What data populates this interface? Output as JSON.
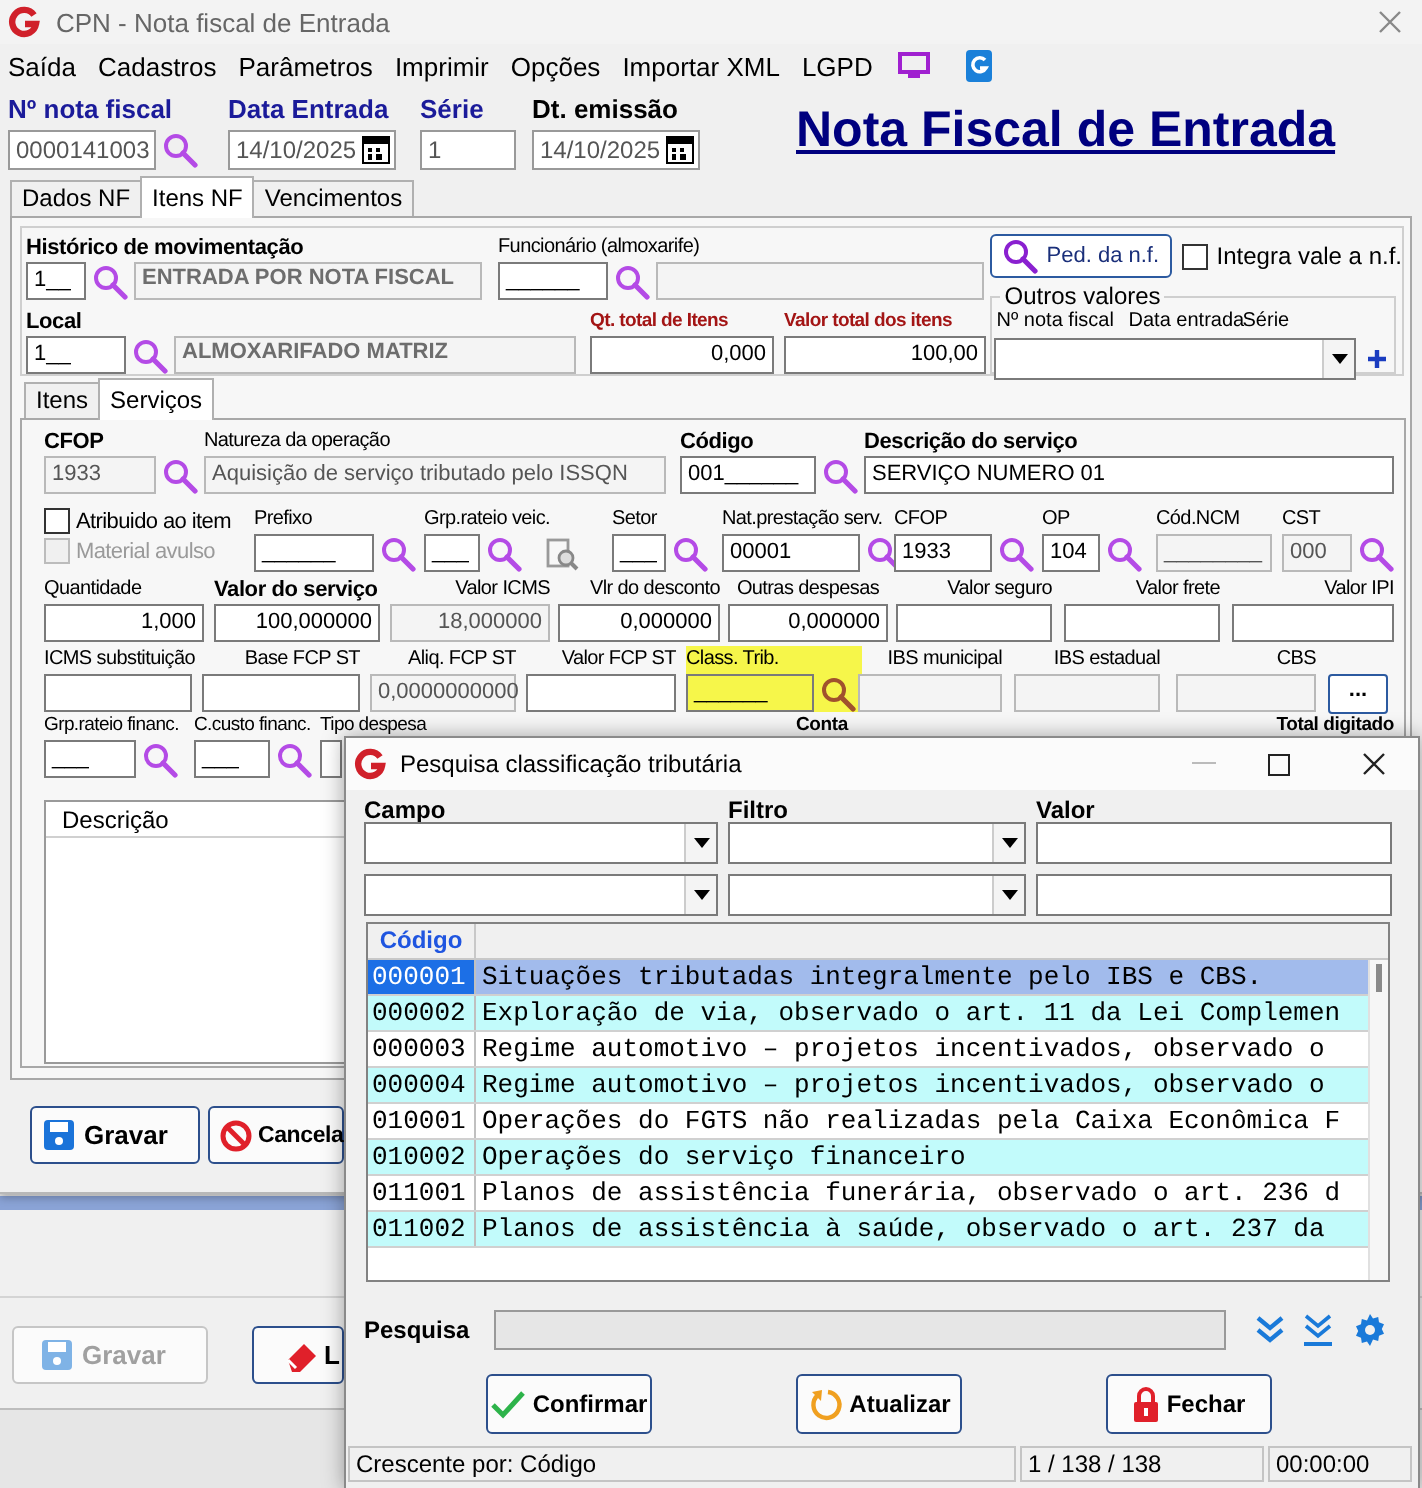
{
  "window": {
    "title": "CPN - Nota fiscal de Entrada"
  },
  "menu": [
    "Saída",
    "Cadastros",
    "Parâmetros",
    "Imprimir",
    "Opções",
    "Importar XML",
    "LGPD"
  ],
  "header": {
    "fields": [
      {
        "label": "Nº nota fiscal",
        "value": "0000141003",
        "kind": "lookup"
      },
      {
        "label": "Data Entrada",
        "value": "14/10/2025",
        "kind": "date"
      },
      {
        "label": "Série",
        "value": "1",
        "kind": "field"
      },
      {
        "label": "Dt. emissão",
        "value": "14/10/2025",
        "kind": "date"
      }
    ],
    "title": "Nota Fiscal de Entrada"
  },
  "tabs": [
    {
      "label": "Dados NF",
      "selected": false
    },
    {
      "label": "Itens NF",
      "selected": true
    },
    {
      "label": "Vencimentos",
      "selected": false
    }
  ],
  "movimento": {
    "historico": {
      "label": "Histórico de movimentação",
      "code": "1__",
      "description": "ENTRADA POR NOTA FISCAL"
    },
    "funcionario": {
      "label": "Funcionário (almoxarife)",
      "code": "______"
    },
    "local": {
      "label": "Local",
      "code": "1__",
      "description": "ALMOXARIFADO MATRIZ"
    },
    "totals": [
      {
        "label": "Qt. total de Itens",
        "value": "0,000"
      },
      {
        "label": "Valor total dos itens",
        "value": "100,00"
      }
    ],
    "ped_button": "Ped. da n.f.",
    "integra_vale": {
      "label": "Integra vale a n.f.",
      "checked": false
    },
    "outros_valores": {
      "title": "Outros valores",
      "columns": [
        "Nº nota fiscal",
        "Data entrada",
        "Série"
      ]
    }
  },
  "subtabs": [
    {
      "label": "Itens",
      "selected": false
    },
    {
      "label": "Serviços",
      "selected": true
    }
  ],
  "servico": {
    "row_1": [
      {
        "label": "CFOP",
        "value": "1933",
        "kind": "readonly-lookup"
      },
      {
        "label": "Natureza da operação",
        "value": "Aquisição de serviço tributado pelo ISSQN",
        "kind": "readonly"
      },
      {
        "label": "Código",
        "value": "001______",
        "kind": "lookup"
      },
      {
        "label": "Descrição do serviço",
        "value": "SERVIÇO NUMERO 01",
        "kind": "field"
      }
    ],
    "options": [
      {
        "label": "Atribuido ao item",
        "checked": false,
        "disabled": false
      },
      {
        "label": "Material avulso",
        "checked": false,
        "disabled": true
      }
    ],
    "row_2": [
      {
        "label": "Prefixo",
        "value": "______",
        "kind": "lookup"
      },
      {
        "label": "Grp.rateio veic.",
        "value": "___",
        "kind": "lookup-tool"
      },
      {
        "label": "Setor",
        "value": "___",
        "kind": "lookup"
      },
      {
        "label": "Nat.prestação serv.",
        "value": "00001",
        "kind": "lookup"
      },
      {
        "label": "CFOP",
        "value": "1933",
        "kind": "lookup"
      },
      {
        "label": "OP",
        "value": "104",
        "kind": "lookup"
      },
      {
        "label": "Cód.NCM",
        "value": "________",
        "kind": "readonly"
      },
      {
        "label": "CST",
        "value": "000",
        "kind": "readonly-lookup"
      }
    ],
    "row_3": [
      {
        "label": "Quantidade",
        "value": "1,000",
        "kind": "field"
      },
      {
        "label": "Valor do serviço",
        "value": "100,000000",
        "kind": "field"
      },
      {
        "label": "Valor ICMS",
        "value": "18,000000",
        "kind": "readonly"
      },
      {
        "label": "Vlr do desconto",
        "value": "0,000000",
        "kind": "field"
      },
      {
        "label": "Outras despesas",
        "value": "0,000000",
        "kind": "field"
      },
      {
        "label": "Valor seguro",
        "kind": "field"
      },
      {
        "label": "Valor frete",
        "kind": "field"
      },
      {
        "label": "Valor IPI",
        "kind": "field"
      }
    ],
    "row_4": [
      {
        "label": "ICMS substituição",
        "kind": "field",
        "highlighted": false
      },
      {
        "label": "Base FCP ST",
        "kind": "field",
        "highlighted": false
      },
      {
        "label": "Aliq. FCP ST",
        "value": "0,0000000000",
        "kind": "readonly",
        "highlighted": false
      },
      {
        "label": "Valor FCP ST",
        "kind": "field",
        "highlighted": false
      },
      {
        "label": "Class. Trib.",
        "value": "______",
        "kind": "lookup",
        "highlighted": true
      },
      {
        "label": "IBS municipal",
        "kind": "readonly",
        "highlighted": false
      },
      {
        "label": "IBS estadual",
        "kind": "readonly",
        "highlighted": false
      },
      {
        "label": "CBS",
        "kind": "readonly",
        "highlighted": false
      }
    ],
    "more_button": "...",
    "row_5": [
      {
        "label": "Grp.rateio financ.",
        "value": "___",
        "kind": "lookup"
      },
      {
        "label": "C.custo financ.",
        "value": "___",
        "kind": "lookup"
      },
      {
        "label": "Tipo despesa",
        "kind": "field"
      },
      {
        "label": "Conta",
        "kind": "label"
      },
      {
        "label": "Total digitado",
        "kind": "label"
      }
    ],
    "table": {
      "columns": [
        "Descrição"
      ]
    }
  },
  "actions": [
    {
      "label": "Gravar",
      "kind": "save"
    },
    {
      "label": "Cancela",
      "kind": "cancel"
    }
  ],
  "background": {
    "actions": [
      {
        "label": "Gravar",
        "kind": "save",
        "disabled": true
      },
      {
        "label": "L",
        "kind": "clear",
        "disabled": false
      }
    ]
  },
  "dialog": {
    "title": "Pesquisa classificação tributária",
    "filter_labels": [
      "Campo",
      "Filtro",
      "Valor"
    ],
    "grid": {
      "columns": [
        "Código"
      ],
      "rows": [
        {
          "code": "000001",
          "description": "Situações tributadas integralmente pelo IBS e CBS.",
          "selected": true
        },
        {
          "code": "000002",
          "description": "Exploração de via, observado o art. 11 da Lei Complemen",
          "selected": false
        },
        {
          "code": "000003",
          "description": "Regime automotivo – projetos incentivados, observado o",
          "selected": false
        },
        {
          "code": "000004",
          "description": "Regime automotivo – projetos incentivados, observado o",
          "selected": false
        },
        {
          "code": "010001",
          "description": "Operações do FGTS não realizadas pela Caixa Econômica F",
          "selected": false
        },
        {
          "code": "010002",
          "description": "Operações do serviço financeiro",
          "selected": false
        },
        {
          "code": "011001",
          "description": "Planos de assistência funerária, observado o art. 236 d",
          "selected": false
        },
        {
          "code": "011002",
          "description": "Planos de assistência à saúde, observado o art. 237 da",
          "selected": false
        }
      ]
    },
    "search_label": "Pesquisa",
    "buttons": [
      {
        "label": "Confirmar",
        "kind": "confirm"
      },
      {
        "label": "Atualizar",
        "kind": "refresh"
      },
      {
        "label": "Fechar",
        "kind": "close"
      }
    ],
    "status": {
      "sort": "Crescente por: Código",
      "count": "1 / 138 / 138",
      "time": "00:00:00"
    }
  }
}
